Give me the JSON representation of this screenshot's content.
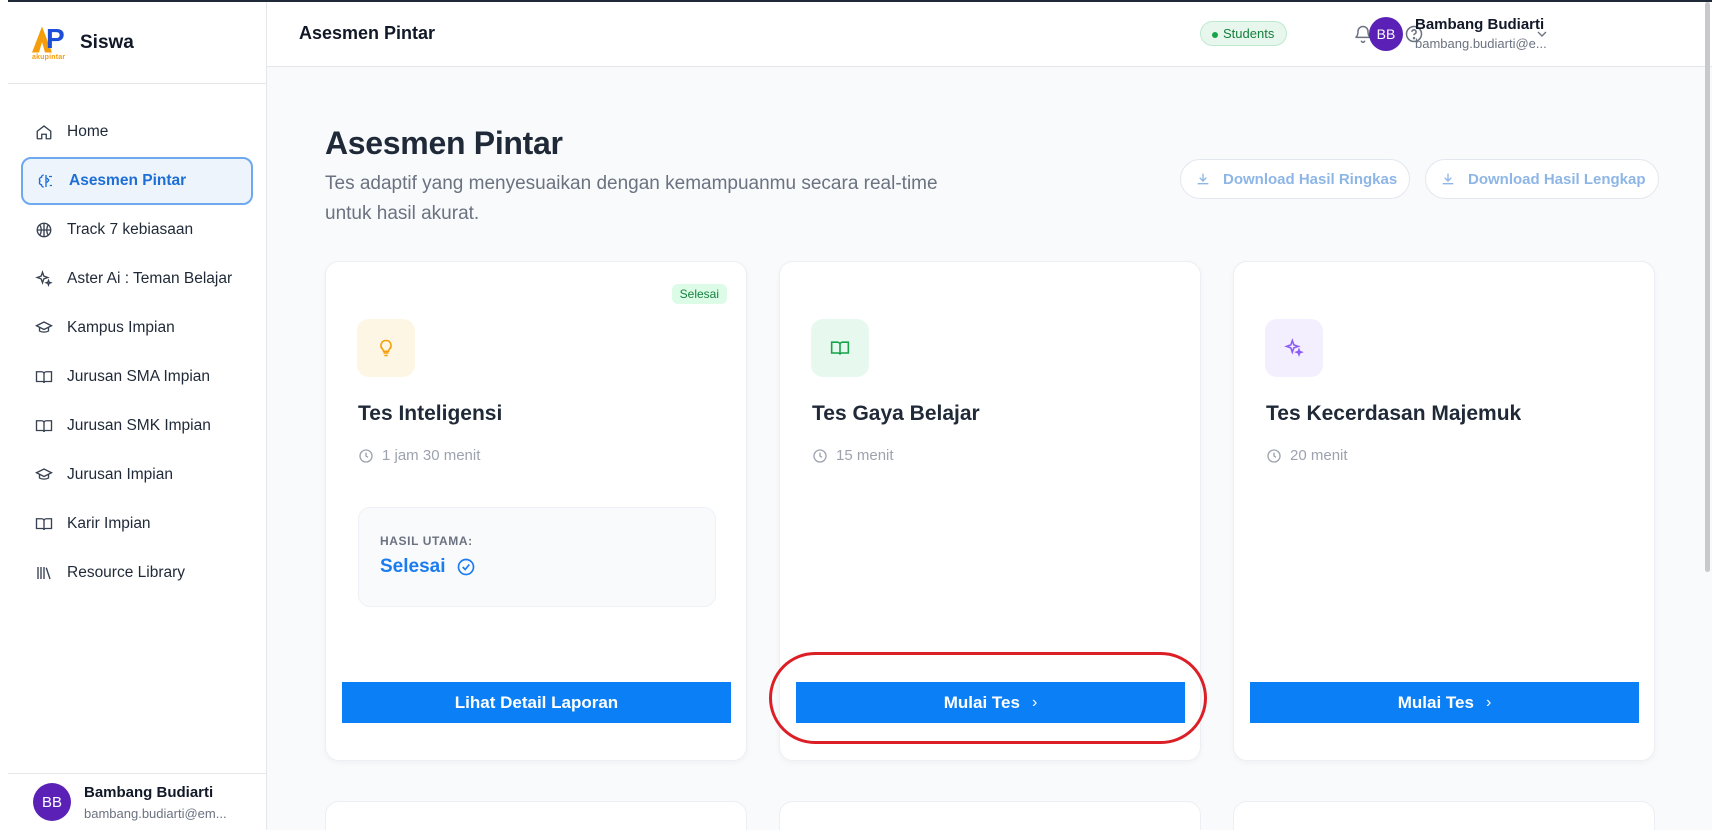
{
  "app": {
    "brand_name": "Siswa",
    "logo_text": "AP",
    "logo_small": "akupintar"
  },
  "sidebar": {
    "items": [
      {
        "label": "Home",
        "icon": "home-icon",
        "active": false
      },
      {
        "label": "Asesmen Pintar",
        "icon": "brain-icon",
        "active": true
      },
      {
        "label": "Track 7 kebiasaan",
        "icon": "basketball-icon",
        "active": false
      },
      {
        "label": "Aster Ai : Teman Belajar",
        "icon": "sparkles-icon",
        "active": false
      },
      {
        "label": "Kampus Impian",
        "icon": "graduation-cap-icon",
        "active": false
      },
      {
        "label": "Jurusan SMA Impian",
        "icon": "open-book-icon",
        "active": false
      },
      {
        "label": "Jurusan SMK Impian",
        "icon": "open-book-icon",
        "active": false
      },
      {
        "label": "Jurusan Impian",
        "icon": "graduation-cap-icon",
        "active": false
      },
      {
        "label": "Karir Impian",
        "icon": "open-book-icon",
        "active": false
      },
      {
        "label": "Resource Library",
        "icon": "library-icon",
        "active": false
      }
    ],
    "user": {
      "initials": "BB",
      "name": "Bambang Budiarti",
      "email": "bambang.budiarti@em..."
    }
  },
  "topbar": {
    "title": "Asesmen Pintar",
    "role_badge": "Students",
    "user": {
      "initials": "BB",
      "name": "Bambang Budiarti",
      "email": "bambang.budiarti@e..."
    }
  },
  "main": {
    "heading": "Asesmen Pintar",
    "subtitle": "Tes adaptif yang menyesuaikan dengan kemampuanmu secara real-time untuk hasil akurat.",
    "download_summary": "Download Hasil Ringkas",
    "download_full": "Download Hasil Lengkap",
    "cards": [
      {
        "title": "Tes Inteligensi",
        "duration": "1 jam 30 menit",
        "status_badge": "Selesai",
        "icon": "lightbulb-icon",
        "icon_bg": "#fef6e4",
        "icon_color": "#f59e0b",
        "result_label": "HASIL UTAMA:",
        "result_value": "Selesai",
        "button": "Lihat Detail Laporan"
      },
      {
        "title": "Tes Gaya Belajar",
        "duration": "15 menit",
        "icon": "book-open-icon",
        "icon_bg": "#e7f8ee",
        "icon_color": "#16a34a",
        "button": "Mulai Tes"
      },
      {
        "title": "Tes Kecerdasan Majemuk",
        "duration": "20 menit",
        "icon": "sparkles-icon",
        "icon_bg": "#f3efff",
        "icon_color": "#8b5cf6",
        "button": "Mulai Tes"
      }
    ]
  },
  "colors": {
    "primary": "#0b7ff5",
    "active_border": "#6ea8ef",
    "highlight": "#dc1f26"
  }
}
